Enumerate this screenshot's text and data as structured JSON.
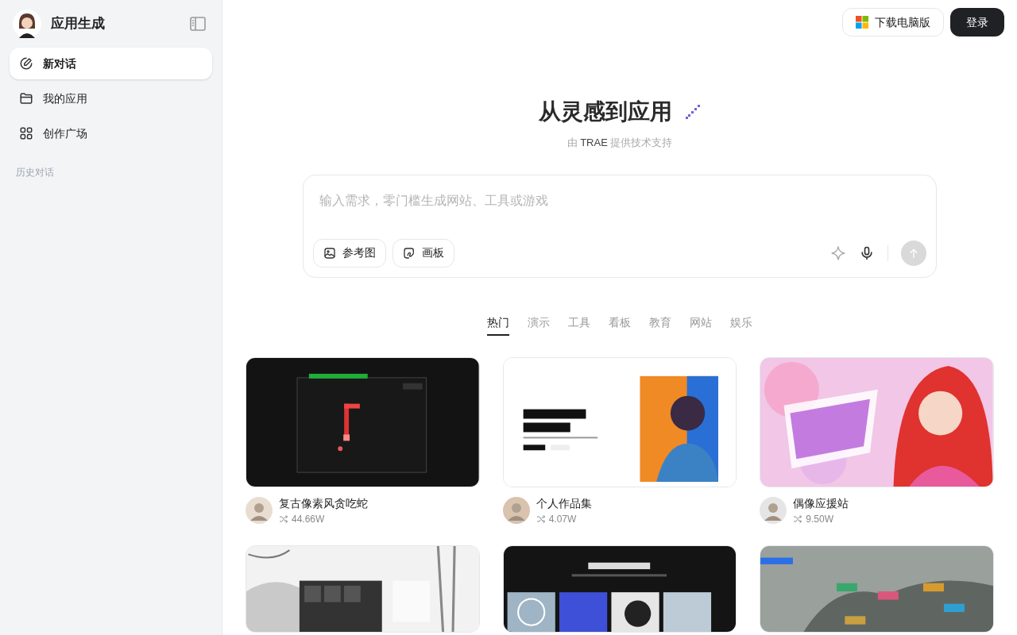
{
  "sidebar": {
    "title": "应用生成",
    "items": [
      {
        "label": "新对话",
        "selected": true
      },
      {
        "label": "我的应用",
        "selected": false
      },
      {
        "label": "创作广场",
        "selected": false
      }
    ],
    "section_label": "历史对话"
  },
  "header": {
    "download_button": "下载电脑版",
    "login_button": "登录"
  },
  "hero": {
    "title": "从灵感到应用",
    "powered_by": {
      "prefix": "由",
      "brand": "TRAE",
      "suffix": "提供技术支持"
    }
  },
  "prompt": {
    "placeholder": "输入需求，零门槛生成网站、工具或游戏",
    "buttons": [
      {
        "label": "参考图"
      },
      {
        "label": "画板"
      }
    ],
    "send_disabled": true
  },
  "tabs": [
    {
      "label": "热门",
      "selected": true
    },
    {
      "label": "演示",
      "selected": false
    },
    {
      "label": "工具",
      "selected": false
    },
    {
      "label": "看板",
      "selected": false
    },
    {
      "label": "教育",
      "selected": false
    },
    {
      "label": "网站",
      "selected": false
    },
    {
      "label": "娱乐",
      "selected": false
    }
  ],
  "cards": [
    {
      "kind": "picture",
      "title": "复古像素风贪吃蛇",
      "plays": "44.66W"
    },
    {
      "kind": "picture",
      "title": "个人作品集",
      "plays": "4.07W"
    },
    {
      "kind": "picture",
      "title": "偶像应援站",
      "plays": "9.50W"
    },
    {
      "kind": "picture"
    },
    {
      "kind": "picture"
    },
    {
      "kind": "picture"
    }
  ]
}
